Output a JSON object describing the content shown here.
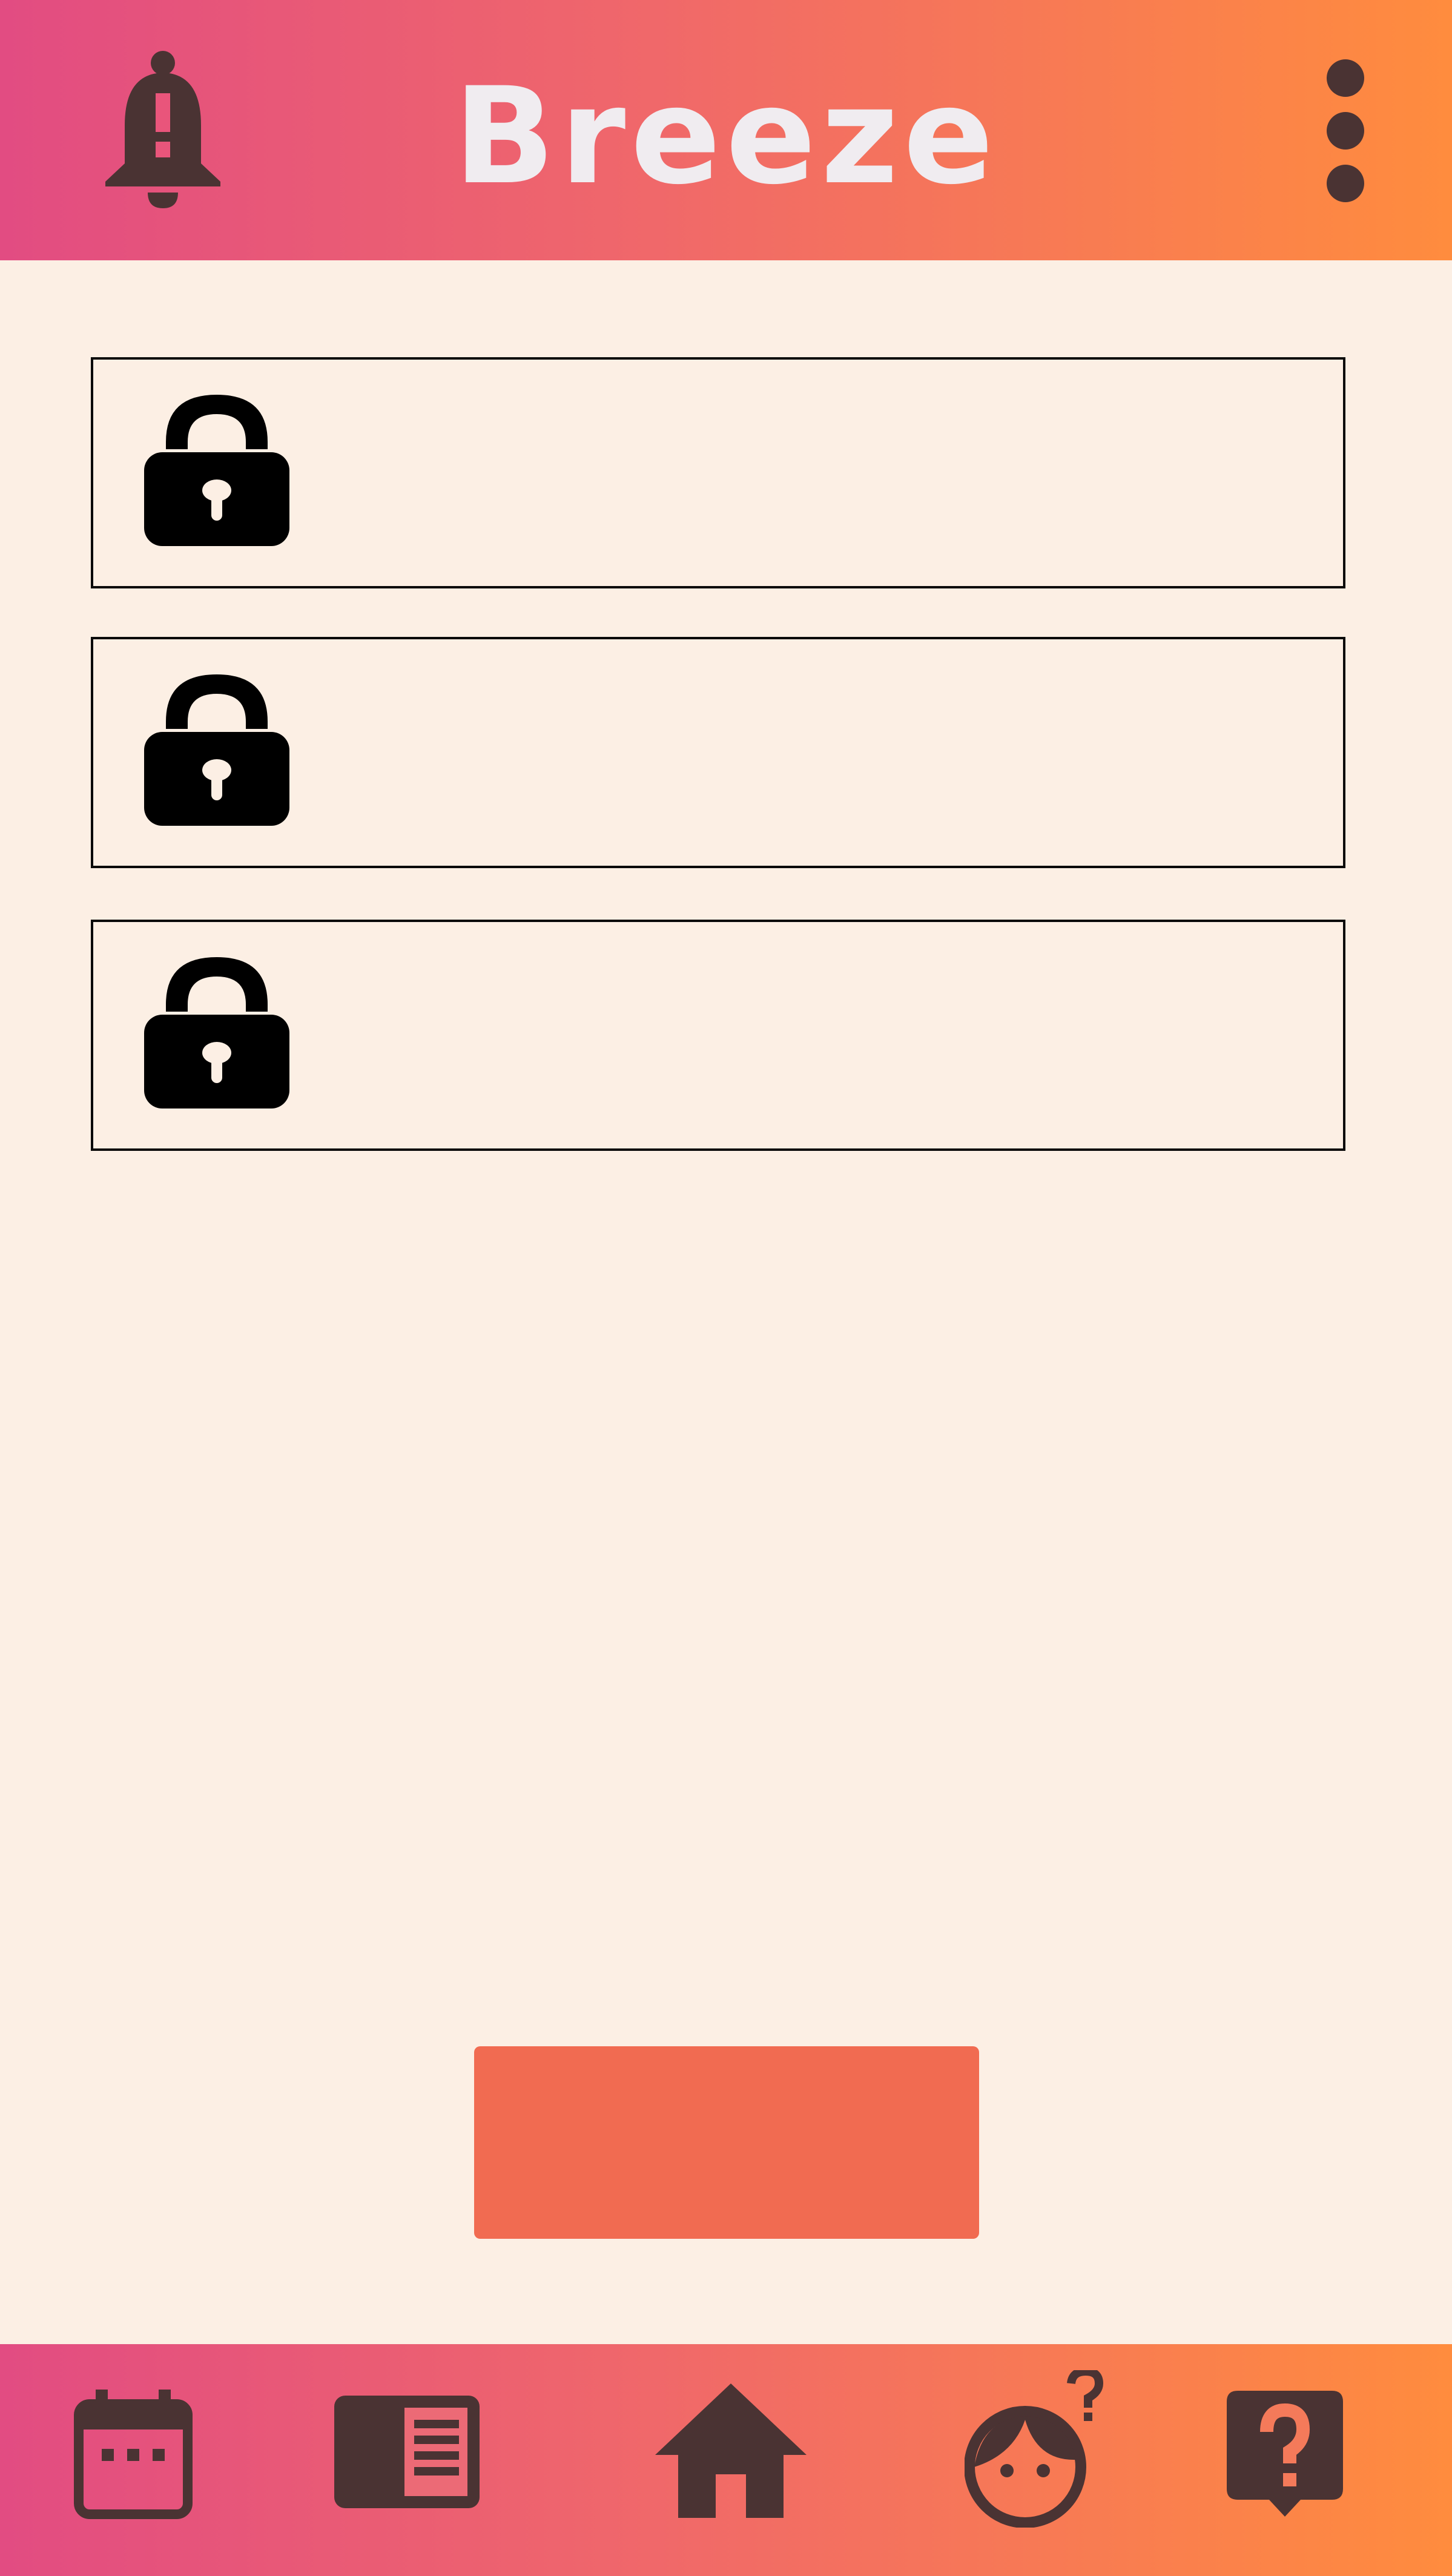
{
  "app": {
    "title": "Breeze"
  },
  "colors": {
    "background": "#fcefe4",
    "bar_gradient_start": "#e24c82",
    "bar_gradient_end": "#ff8c3e",
    "icon_dark": "#4a3333",
    "title_text": "#f0ecf0",
    "primary_button": "#f16b51",
    "card_border": "#0a0a0a"
  },
  "header": {
    "left_icon": "bell-alert-icon",
    "right_icon": "kebab-menu-icon"
  },
  "cards": [
    {
      "icon": "lock-icon",
      "label": ""
    },
    {
      "icon": "lock-icon",
      "label": ""
    },
    {
      "icon": "lock-icon",
      "label": ""
    }
  ],
  "primary_button": {
    "label": ""
  },
  "bottom_nav": [
    {
      "icon": "calendar-icon"
    },
    {
      "icon": "newspaper-icon"
    },
    {
      "icon": "home-icon"
    },
    {
      "icon": "person-question-icon"
    },
    {
      "icon": "help-chat-icon"
    }
  ]
}
